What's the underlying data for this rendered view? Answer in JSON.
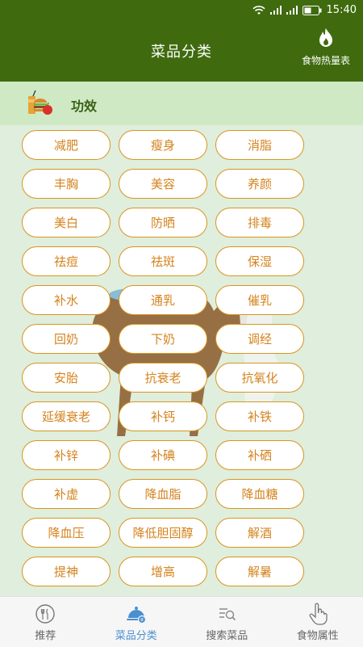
{
  "status": {
    "time": "15:40"
  },
  "header": {
    "title": "菜品分类",
    "calorie_label": "食物热量表"
  },
  "section": {
    "title": "功效"
  },
  "tags": [
    "减肥",
    "瘦身",
    "消脂",
    "丰胸",
    "美容",
    "养颜",
    "美白",
    "防晒",
    "排毒",
    "祛痘",
    "祛斑",
    "保湿",
    "补水",
    "通乳",
    "催乳",
    "回奶",
    "下奶",
    "调经",
    "安胎",
    "抗衰老",
    "抗氧化",
    "延缓衰老",
    "补钙",
    "补铁",
    "补锌",
    "补碘",
    "补硒",
    "补虚",
    "降血脂",
    "降血糖",
    "降血压",
    "降低胆固醇",
    "解酒",
    "提神",
    "增高",
    "解暑"
  ],
  "tabs": [
    {
      "label": "推荐",
      "icon": "fork-knife-icon",
      "active": false
    },
    {
      "label": "菜品分类",
      "icon": "dish-cloche-icon",
      "active": true
    },
    {
      "label": "搜索菜品",
      "icon": "search-list-icon",
      "active": false
    },
    {
      "label": "食物属性",
      "icon": "hand-pointer-icon",
      "active": false
    }
  ],
  "colors": {
    "header": "#3f6b0e",
    "section_bar": "#cfe9c5",
    "tag_border": "#d9951c",
    "tag_text": "#d4831d",
    "active_tab": "#4a8fd0"
  }
}
